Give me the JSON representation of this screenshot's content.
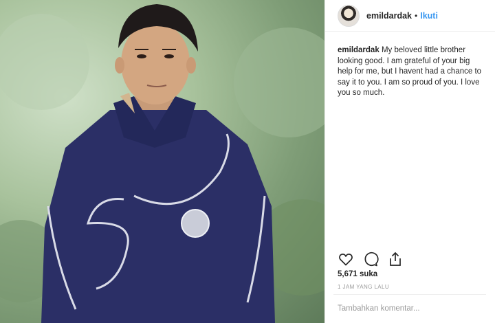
{
  "post": {
    "username": "emildardak",
    "separator": "•",
    "follow_label": "Ikuti",
    "caption_user": "emildardak",
    "caption_text": "My beloved little brother looking good. I am grateful of your big help for me, but I havent had a chance to say it to you. I am so proud of you. I love you so much.",
    "likes": "5,671 suka",
    "timestamp": "1 JAM YANG LALU",
    "comment_placeholder": "Tambahkan komentar..."
  },
  "icons": {
    "like": "heart-icon",
    "comment": "comment-icon",
    "share": "share-icon"
  },
  "colors": {
    "accent": "#3897f0",
    "text": "#262626",
    "muted": "#999999",
    "jacket": "#2b2f66"
  }
}
